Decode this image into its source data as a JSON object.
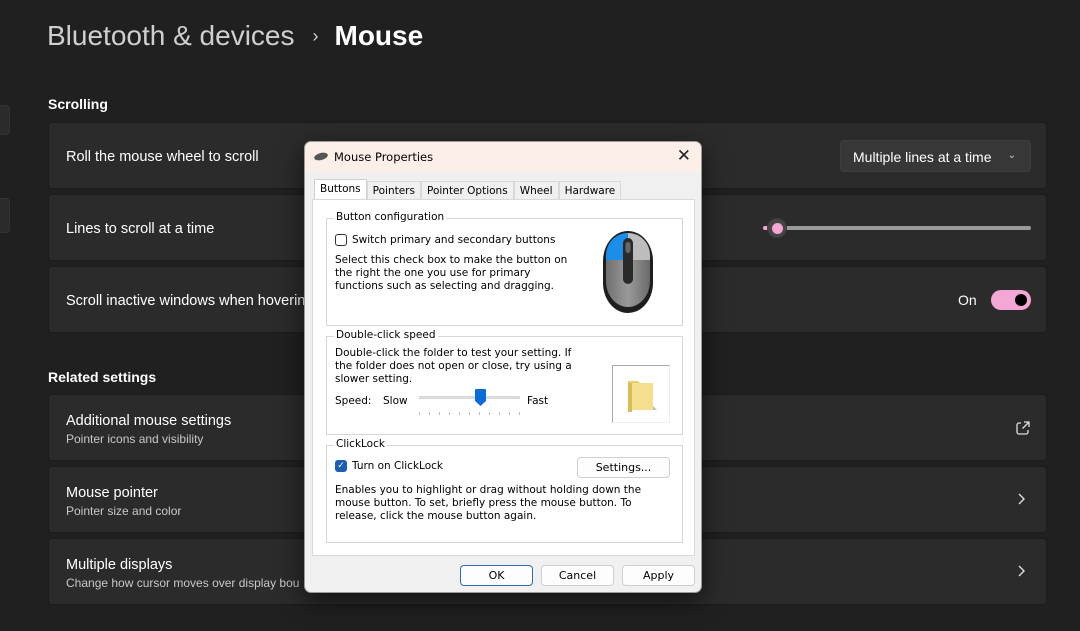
{
  "breadcrumb": {
    "parent": "Bluetooth & devices",
    "separator": "›",
    "current": "Mouse"
  },
  "scrolling": {
    "section_title": "Scrolling",
    "roll_wheel": {
      "label": "Roll the mouse wheel to scroll",
      "selected": "Multiple lines at a time",
      "chevron": "⌄"
    },
    "lines_to_scroll": {
      "label": "Lines to scroll at a time",
      "slider_fraction": 0.03
    },
    "scroll_inactive": {
      "label": "Scroll inactive windows when hovering",
      "state_label": "On",
      "checked": true
    }
  },
  "related": {
    "section_title": "Related settings",
    "items": [
      {
        "title": "Additional mouse settings",
        "subtitle": "Pointer icons and visibility",
        "icon": "external-link-icon"
      },
      {
        "title": "Mouse pointer",
        "subtitle": "Pointer size and color",
        "icon": "chevron-right-icon"
      },
      {
        "title": "Multiple displays",
        "subtitle": "Change how cursor moves over display bou",
        "icon": "chevron-right-icon"
      }
    ]
  },
  "dialog": {
    "title": "Mouse Properties",
    "close": "✕",
    "tabs": [
      "Buttons",
      "Pointers",
      "Pointer Options",
      "Wheel",
      "Hardware"
    ],
    "active_tab": "Buttons",
    "button_config": {
      "label": "Button configuration",
      "checkbox_label": "Switch primary and secondary buttons",
      "checked": false,
      "description": "Select this check box to make the button on the right the one you use for primary functions such as selecting and dragging."
    },
    "double_click": {
      "label": "Double-click speed",
      "description": "Double-click the folder to test your setting. If the folder does not open or close, try using a slower setting.",
      "speed_label": "Speed:",
      "slow_label": "Slow",
      "fast_label": "Fast",
      "speed_fraction": 0.6
    },
    "clicklock": {
      "label": "ClickLock",
      "checkbox_label": "Turn on ClickLock",
      "checked": true,
      "settings_button": "Settings...",
      "description": "Enables you to highlight or drag without holding down the mouse button. To set, briefly press the mouse button. To release, click the mouse button again."
    },
    "buttons": {
      "ok": "OK",
      "cancel": "Cancel",
      "apply": "Apply"
    }
  },
  "colors": {
    "accent": "#f4a7d4",
    "dialog_accent": "#1a5fb4",
    "background": "#202020",
    "card": "#2b2b2b"
  }
}
